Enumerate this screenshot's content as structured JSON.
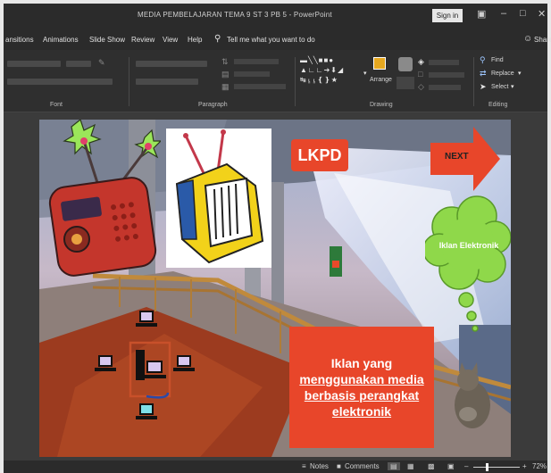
{
  "window": {
    "title": "MEDIA PEMBELAJARAN TEMA 9 ST 3 PB 5  -  PowerPoint",
    "sign_in": "Sign in"
  },
  "menu": {
    "items": [
      "ansitions",
      "Animations",
      "Slide Show",
      "Review",
      "View",
      "Help"
    ],
    "tell_me": "Tell me what you want to do",
    "share": "Share"
  },
  "ribbon": {
    "groups": {
      "font": "Font",
      "paragraph": "Paragraph",
      "drawing": "Drawing",
      "editing": "Editing"
    },
    "arrange": "Arrange",
    "find": "Find",
    "replace": "Replace",
    "select": "Select"
  },
  "slide": {
    "lkpd": "LKPD",
    "next": "NEXT",
    "cloud": "Iklan Elektronik",
    "main_line1": "Iklan yang",
    "main_line2": "menggunakan media",
    "main_line3": "berbasis perangkat",
    "main_line4": "elektronik"
  },
  "status": {
    "notes": "Notes",
    "comments": "Comments",
    "zoom": "72%"
  },
  "colors": {
    "orange_box": "#e8462a",
    "cloud_green": "#8fd84a",
    "radio_red": "#c4362c",
    "tv_yellow": "#f2d21a"
  }
}
